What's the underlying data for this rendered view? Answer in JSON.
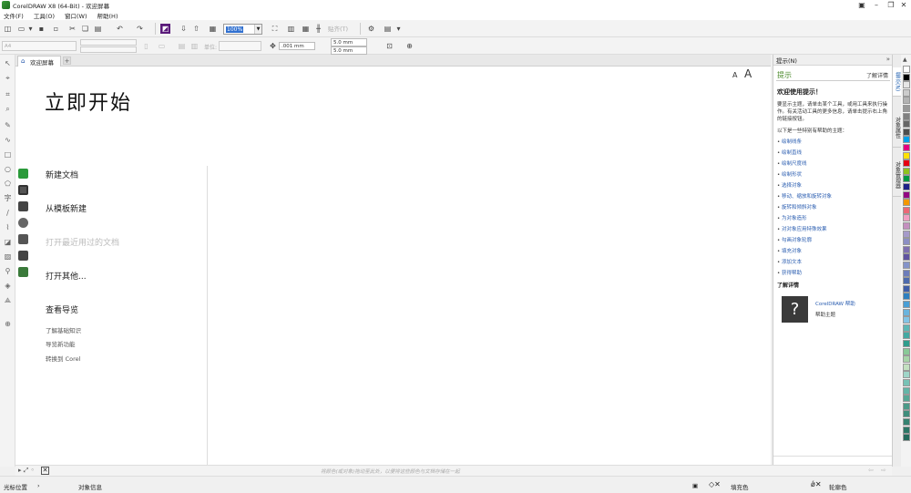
{
  "window": {
    "title": "CorelDRAW X8 (64-Bit) - 欢迎屏幕",
    "controls": [
      "pin-icon",
      "minimize-icon",
      "restore-icon",
      "close-icon"
    ]
  },
  "menu": [
    "文件(F)",
    "工具(O)",
    "窗口(W)",
    "帮助(H)"
  ],
  "toolbar": {
    "zoom_value": "100%",
    "snap_to_label": "贴齐(T)"
  },
  "propbar": {
    "units_label": "单位:",
    "nudge_value": ".001 mm",
    "dup_x": "5.0 mm",
    "dup_y": "5.0 mm"
  },
  "tabs": {
    "welcome_tab": "欢迎屏幕"
  },
  "welcome": {
    "heading": "立即开始",
    "font_small": "A",
    "font_large": "A",
    "actions": [
      "新建文档",
      "从模板新建",
      "打开最近用过的文档",
      "打开其他...",
      "查看导览"
    ],
    "sub_links": [
      "了解基础知识",
      "导览新功能",
      "转换到 Corel"
    ]
  },
  "hints": {
    "header": "提示(N)",
    "title": "提示",
    "more": "了解详情",
    "welcome": "欢迎使用提示！",
    "intro": "要显示主题，请单击某个工具，或用工具来执行操作。有关活动工具的更多信息，请单击提示右上角的链接按钮。",
    "topics_label": "以下是一些特别有帮助的主题：",
    "topics": [
      "绘制线条",
      "绘制直线",
      "绘制尺度线",
      "绘制形状",
      "选择对象",
      "移动、缩放和旋转对象",
      "旋转和倾斜对象",
      "为对象造形",
      "对对象应用特殊效果",
      "勾画对象轮廓",
      "填充对象",
      "添加文本",
      "获得帮助"
    ],
    "learn_more": "了解详情",
    "help_box": "?",
    "help_link": "CorelDRAW 帮助",
    "help_sub": "帮助主题"
  },
  "side_tabs": [
    "提示(N)",
    "对象属性",
    "对象管理器"
  ],
  "palette_colors": [
    "#ffffff",
    "#000000",
    "#e6e6e6",
    "#cccccc",
    "#b3b3b3",
    "#999999",
    "#808080",
    "#666666",
    "#4d4d4d",
    "#00a0e9",
    "#e4007f",
    "#ffe100",
    "#e60012",
    "#8fc31f",
    "#009944",
    "#1d2088",
    "#920783",
    "#f39800",
    "#eb6877",
    "#f19ec2",
    "#c490bf",
    "#a59aca",
    "#8c8fc4",
    "#7e6fb0",
    "#5f52a0",
    "#8493c9",
    "#6c7cba",
    "#4d6aad",
    "#3f5da8",
    "#2e7fbf",
    "#4a9fd5",
    "#6ab4de",
    "#82c4e6",
    "#5bb7b5",
    "#43a9a2",
    "#2f9d8c",
    "#89c997",
    "#a7d4a8",
    "#c3e0c0",
    "#9fd5c8",
    "#78c2b6",
    "#63b5a7",
    "#56a795",
    "#4b9a88",
    "#3f8e7c",
    "#358271",
    "#2c7666",
    "#246a5c"
  ],
  "docnav": {
    "hint": "将颜色(或对象)拖动至此处，以便将这些颜色与文档存储在一起"
  },
  "status": {
    "cursor_label": "光标位置",
    "object_info": "对象信息",
    "fill_label": "填充色",
    "outline_label": "轮廓色"
  }
}
